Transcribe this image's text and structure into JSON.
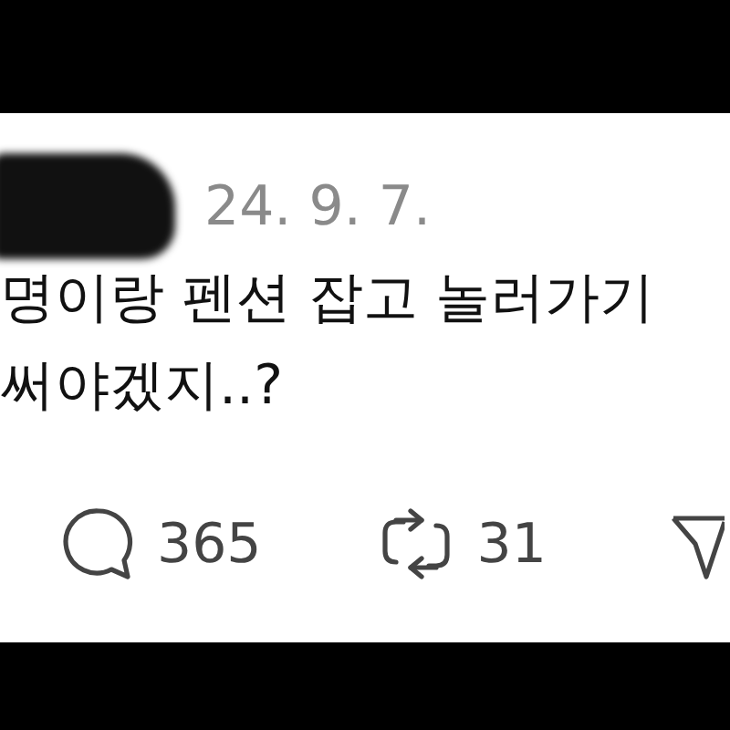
{
  "post": {
    "date": "24. 9. 7.",
    "lines": [
      "명이랑 펜션 잡고 놀러가기",
      "써야겠지..?"
    ]
  },
  "actions": [
    {
      "kind": "reply",
      "count": "365"
    },
    {
      "kind": "repost",
      "count": "31"
    },
    {
      "kind": "share"
    }
  ]
}
